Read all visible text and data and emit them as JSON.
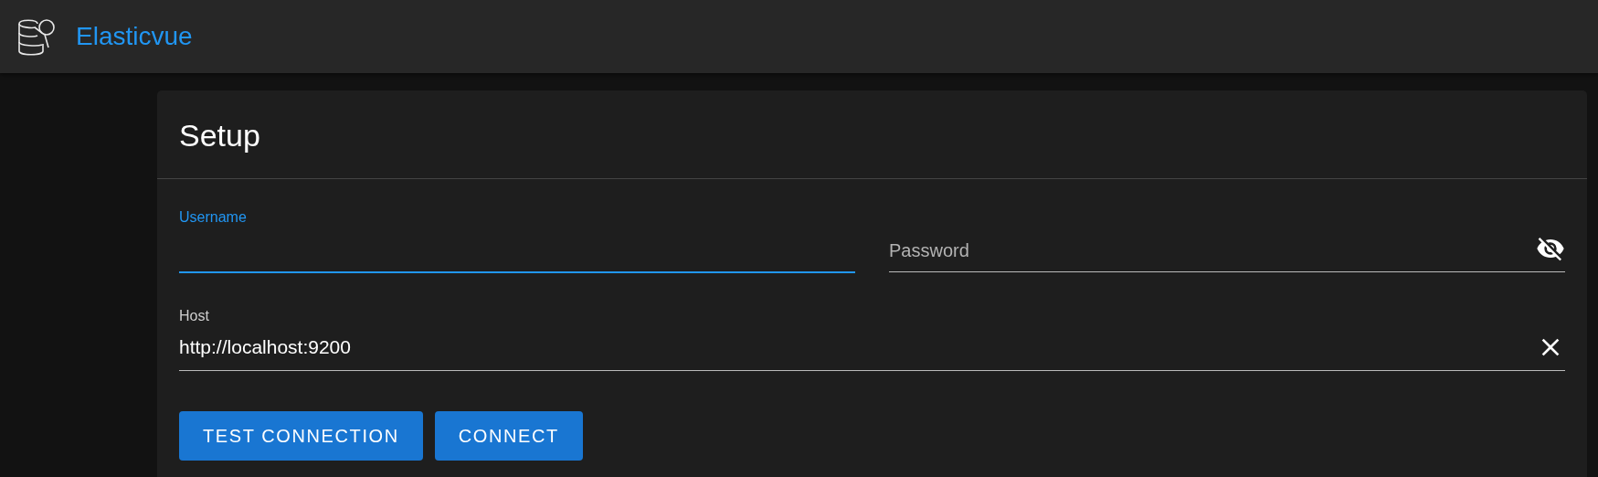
{
  "app_bar": {
    "title": "Elasticvue"
  },
  "card": {
    "title": "Setup",
    "fields": [
      {
        "kind": "text",
        "label": "Username",
        "focused": true
      },
      {
        "kind": "password",
        "label": "Password",
        "focused": false
      },
      {
        "kind": "clearable",
        "label": "Host",
        "value": "http://localhost:9200",
        "focused": false
      }
    ],
    "buttons": [
      "TEST CONNECTION",
      "CONNECT"
    ]
  }
}
